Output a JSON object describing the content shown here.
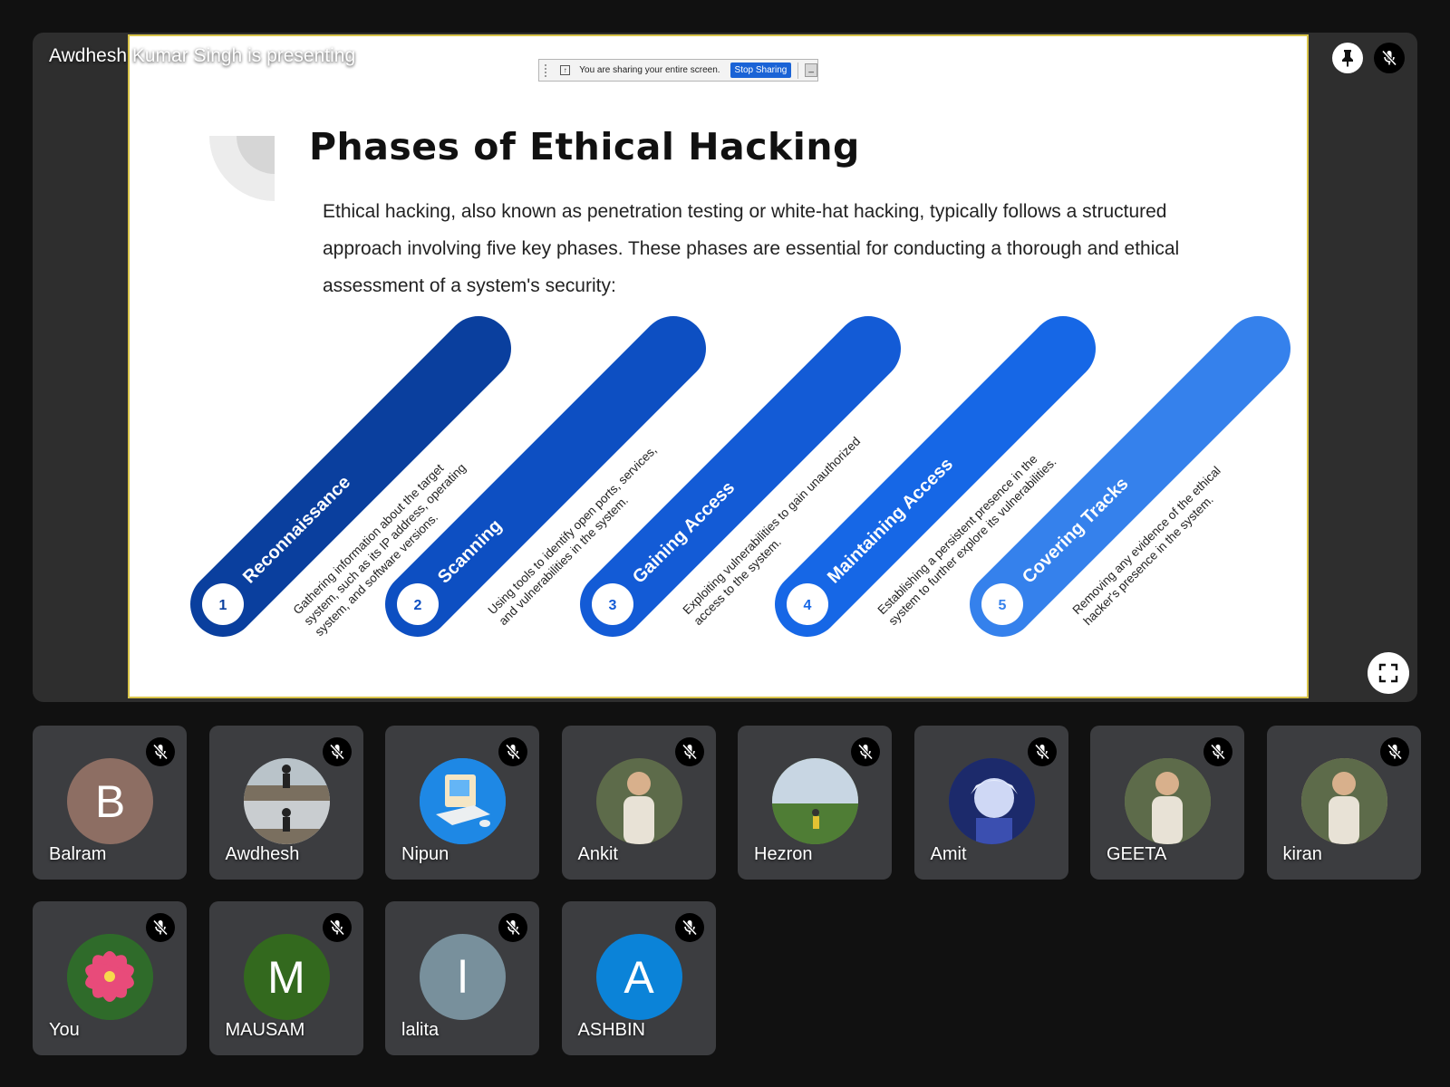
{
  "presenter_label": "Awdhesh Kumar Singh is presenting",
  "share_bar": {
    "text": "You are sharing your entire screen.",
    "stop_label": "Stop Sharing",
    "minimize_label": "_"
  },
  "slide": {
    "title": "Phases of Ethical Hacking",
    "intro": "Ethical hacking, also known as penetration testing or white-hat hacking, typically follows a structured approach involving five key phases. These phases are essential for conducting a thorough and ethical assessment of a system's security:",
    "phases": [
      {
        "number": "1",
        "title": "Reconnaissance",
        "desc_lines": [
          "Gathering information about the target",
          "system, such as its IP address, operating",
          "system, and software versions."
        ],
        "color": "#0a3f9e"
      },
      {
        "number": "2",
        "title": "Scanning",
        "desc_lines": [
          "Using tools to identify open ports, services,",
          "and vulnerabilities in the system."
        ],
        "color": "#0d4fc2"
      },
      {
        "number": "3",
        "title": "Gaining Access",
        "desc_lines": [
          "Exploiting vulnerabilities to gain unauthorized",
          "access to the system."
        ],
        "color": "#135bd6"
      },
      {
        "number": "4",
        "title": "Maintaining Access",
        "desc_lines": [
          "Establishing a persistent presence in the",
          "system to further explore its vulnerabilities."
        ],
        "color": "#1667e6"
      },
      {
        "number": "5",
        "title": "Covering Tracks",
        "desc_lines": [
          "Removing any evidence of the ethical",
          "hacker's presence in the system."
        ],
        "color": "#3581ec"
      }
    ]
  },
  "icons": {
    "pin": "pin-icon",
    "mic_off": "mic-off-icon",
    "fullscreen": "fullscreen-icon"
  },
  "participants": [
    {
      "name": "Balram",
      "initial": "B",
      "avatar_color": "#8d6e63",
      "avatar_type": "initial"
    },
    {
      "name": "Awdhesh",
      "initial": "",
      "avatar_color": "#8a8f94",
      "avatar_type": "photo-silhouette"
    },
    {
      "name": "Nipun",
      "initial": "",
      "avatar_color": "#1e88e5",
      "avatar_type": "photo-computer"
    },
    {
      "name": "Ankit",
      "initial": "",
      "avatar_color": "#4a3b2f",
      "avatar_type": "photo-person"
    },
    {
      "name": "Hezron",
      "initial": "",
      "avatar_color": "#6f9a4a",
      "avatar_type": "photo-landscape"
    },
    {
      "name": "Amit",
      "initial": "",
      "avatar_color": "#2a3a8f",
      "avatar_type": "photo-anime"
    },
    {
      "name": "GEETA",
      "initial": "",
      "avatar_color": "#7b8a56",
      "avatar_type": "photo-person"
    },
    {
      "name": "kiran",
      "initial": "",
      "avatar_color": "#c9a27a",
      "avatar_type": "photo-person"
    },
    {
      "name": "You",
      "initial": "",
      "avatar_color": "#2f6b2a",
      "avatar_type": "photo-flower"
    },
    {
      "name": "MAUSAM",
      "initial": "M",
      "avatar_color": "#33691e",
      "avatar_type": "initial"
    },
    {
      "name": "lalita",
      "initial": "l",
      "avatar_color": "#78909c",
      "avatar_type": "initial"
    },
    {
      "name": "ASHBIN",
      "initial": "A",
      "avatar_color": "#0b83d8",
      "avatar_type": "initial"
    }
  ]
}
